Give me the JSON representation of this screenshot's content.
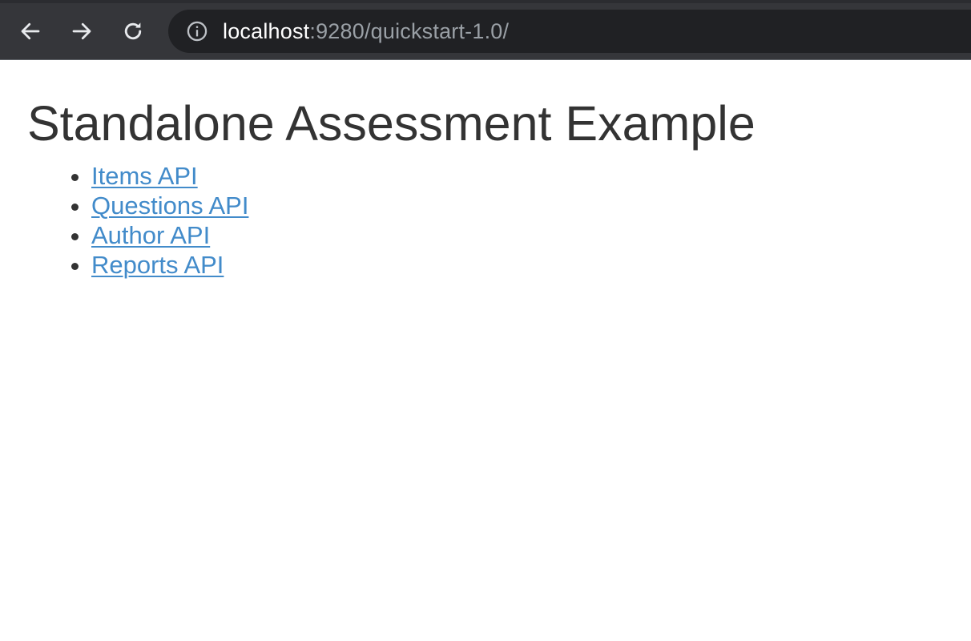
{
  "browser": {
    "icons": {
      "back": "arrow-left-icon",
      "forward": "arrow-right-icon",
      "reload": "reload-icon",
      "site_info": "info-circle-icon"
    },
    "url": {
      "host": "localhost",
      "rest": ":9280/quickstart-1.0/"
    }
  },
  "page": {
    "title": "Standalone Assessment Example",
    "links": [
      {
        "label": "Items API"
      },
      {
        "label": "Questions API"
      },
      {
        "label": "Author API"
      },
      {
        "label": "Reports API"
      }
    ]
  },
  "colors": {
    "toolbar_bg": "#35363a",
    "omnibox_bg": "#202124",
    "url_host": "#ffffff",
    "url_rest": "#9aa0a6",
    "heading_text": "#333333",
    "link": "#428bca"
  }
}
